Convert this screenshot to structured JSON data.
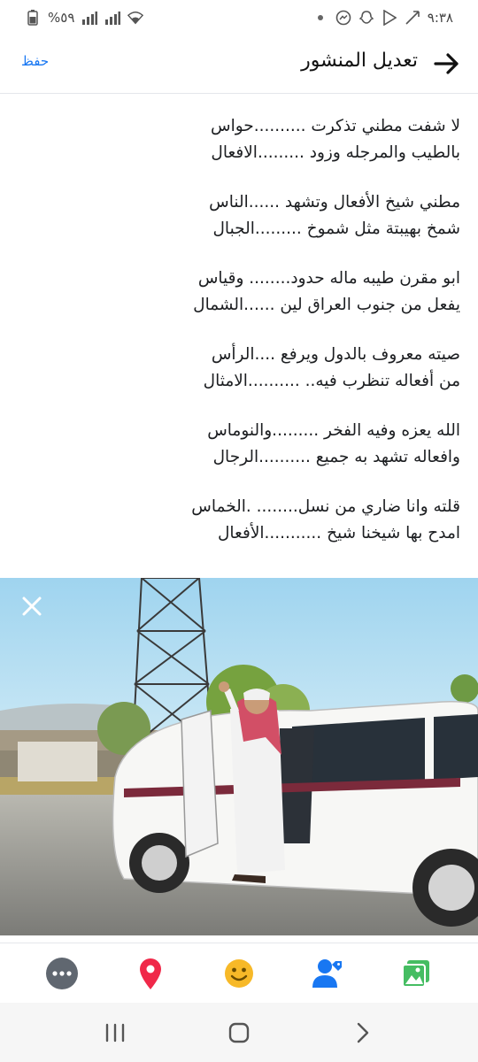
{
  "status_bar": {
    "time": "٩:٣٨",
    "battery": "%٥٩"
  },
  "header": {
    "title": "تعديل المنشور",
    "save_label": "حفظ"
  },
  "post": {
    "stanzas": [
      [
        "لا شفت مطني تذكرت ..........حواس",
        "بالطيب والمرجله وزود .........الافعال"
      ],
      [
        "مطني شيخ الأفعال وتشهد ......الناس",
        "شمخ بهيبتة مثل شموخ .........الجبال"
      ],
      [
        "ابو مقرن طيبه ماله حدود........ وقياس",
        "يفعل من جنوب العراق لين ......الشمال"
      ],
      [
        "صيته معروف بالدول ويرفع ....الرأس",
        "من أفعاله تنظرب فيه.. ..........الامثال"
      ],
      [
        "الله يعزه وفيه الفخر .........والنوماس",
        "وافعاله تشهد به جميع ..........الرجال"
      ],
      [
        "قلته وانا ضاري من نسل........ .الخماس",
        "امدح بها شيخنا شيخ ...........الأفعال"
      ]
    ]
  },
  "colors": {
    "accent": "#1877f2",
    "location": "#f02849",
    "feeling": "#f7b928",
    "tag": "#1877f2",
    "photo": "#45bd62",
    "more": "#606770"
  },
  "toolbar": {
    "icons": [
      "more-icon",
      "location-pin-icon",
      "feeling-smile-icon",
      "tag-people-icon",
      "photo-gallery-icon"
    ]
  },
  "navbar": {
    "icons": [
      "recent-apps-icon",
      "home-icon",
      "back-icon"
    ]
  }
}
